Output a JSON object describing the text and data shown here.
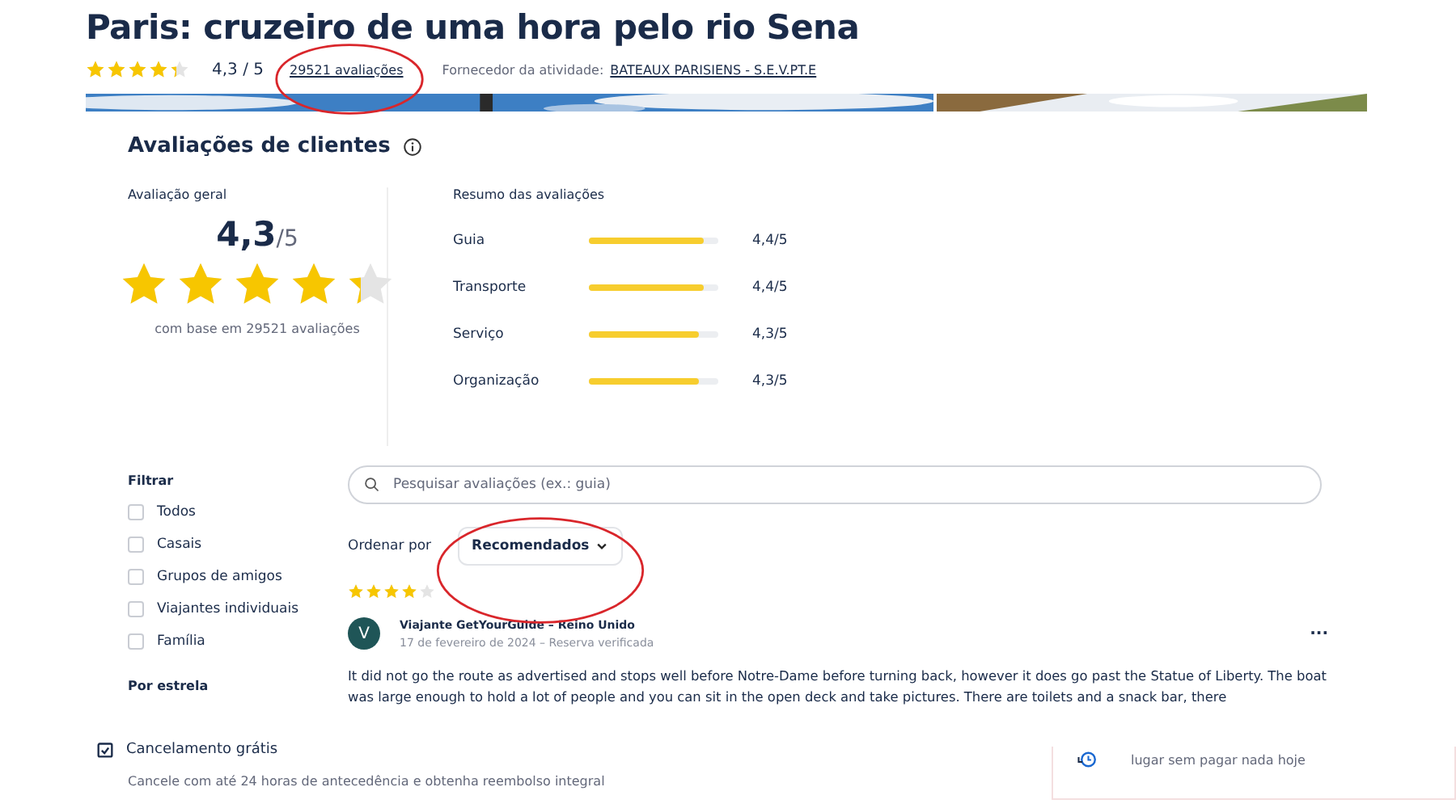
{
  "title": "Paris: cruzeiro de uma hora pelo rio Sena",
  "header": {
    "stars": 4.3,
    "rating": "4,3",
    "rating_max": "/ 5",
    "reviews_link": "29521 avaliações",
    "supplier_label": "Fornecedor da atividade:",
    "supplier": "BATEAUX PARISIENS - S.E.V.PT.E"
  },
  "reviews": {
    "heading": "Avaliações de clientes",
    "overall": {
      "label": "Avaliação geral",
      "score": "4,3",
      "max": "/5",
      "stars": 4.3,
      "basis": "com base em 29521 avaliações"
    },
    "summary": {
      "label": "Resumo das avaliações",
      "items": [
        {
          "name": "Guia",
          "level": 0.89,
          "value": "4,4/5"
        },
        {
          "name": "Transporte",
          "level": 0.89,
          "value": "4,4/5"
        },
        {
          "name": "Serviço",
          "level": 0.85,
          "value": "4,3/5"
        },
        {
          "name": "Organização",
          "level": 0.85,
          "value": "4,3/5"
        }
      ]
    }
  },
  "filter": {
    "label": "Filtrar",
    "options": [
      {
        "label": "Todos",
        "checked": false
      },
      {
        "label": "Casais",
        "checked": false
      },
      {
        "label": "Grupos de amigos",
        "checked": false
      },
      {
        "label": "Viajantes individuais",
        "checked": false
      },
      {
        "label": "Família",
        "checked": false
      }
    ],
    "by_star": "Por estrela"
  },
  "search": {
    "placeholder": "Pesquisar avaliações (ex.: guia)"
  },
  "sort": {
    "label": "Ordenar por",
    "value": "Recomendados"
  },
  "review": {
    "stars": 4,
    "initial": "V",
    "author": "Viajante GetYourGuide – Reino Unido",
    "meta": "17 de fevereiro de 2024 – Reserva verificada",
    "more": "···",
    "text": "It did not go the route as advertised and stops well before Notre-Dame before turning back, however it does go past the Statue of Liberty. The boat was large enough to hold a lot of people and you can sit in the open deck and take pictures. There are toilets and a snack bar, there"
  },
  "footer": {
    "title": "Cancelamento grátis",
    "text": "Cancele com até 24 horas de antecedência e obtenha reembolso integral",
    "card_text": "lugar sem pagar nada hoje"
  }
}
